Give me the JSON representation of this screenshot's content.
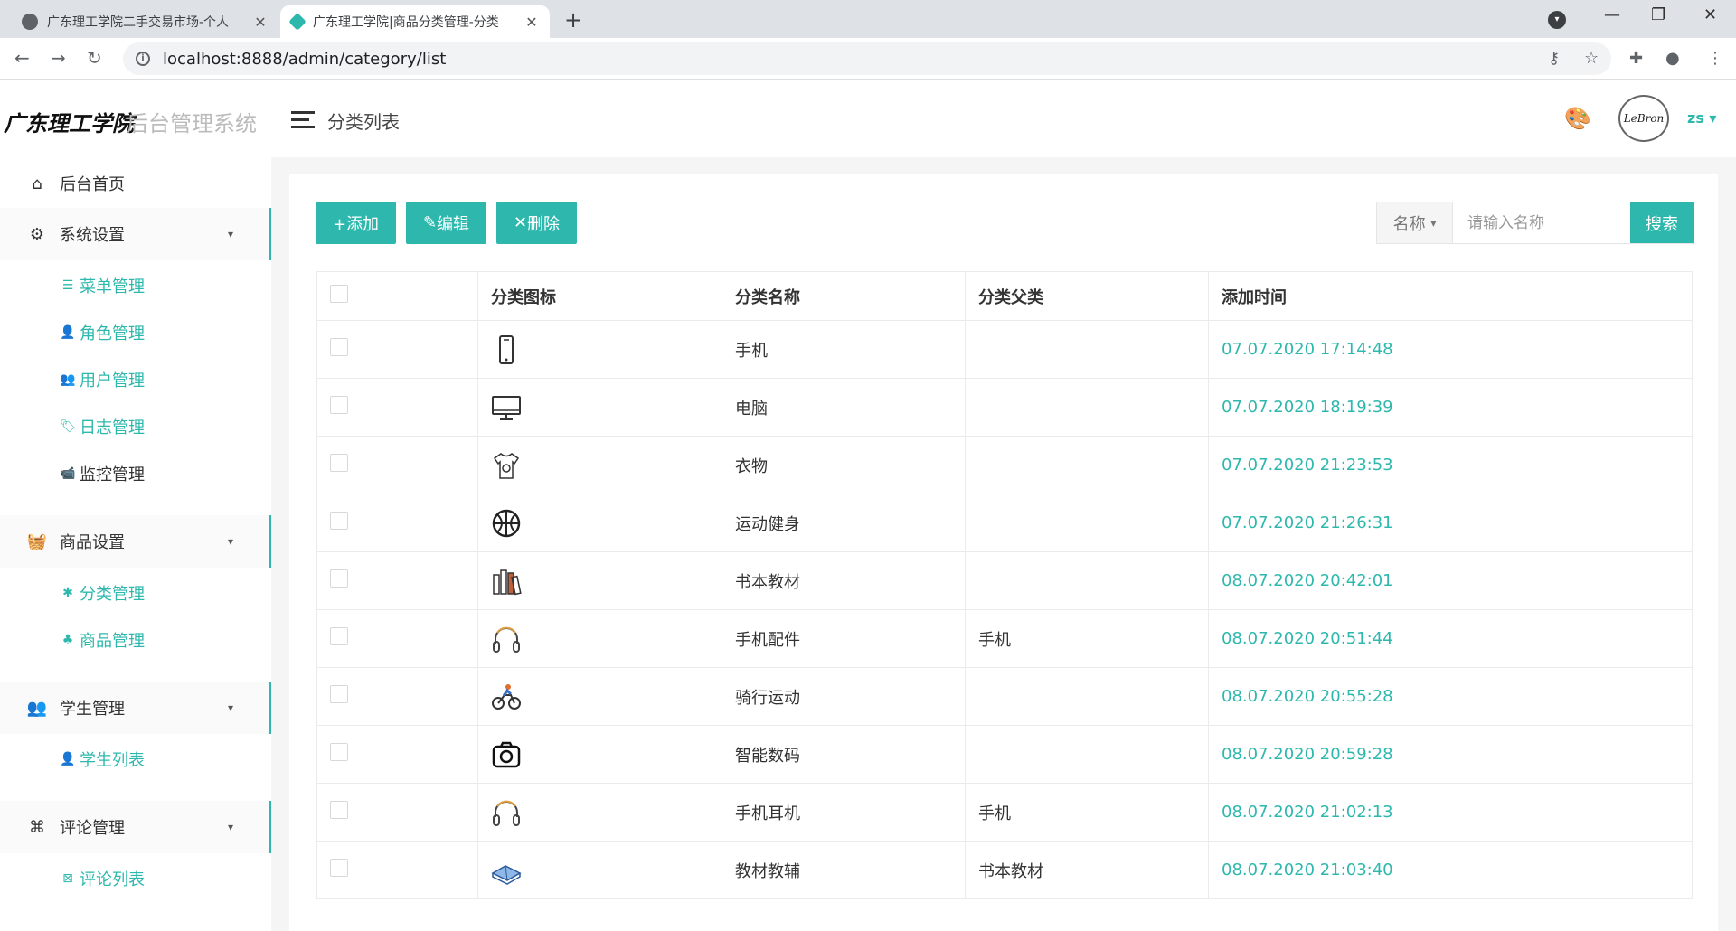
{
  "browser": {
    "tabs": [
      {
        "title": "广东理工学院二手交易市场-个人"
      },
      {
        "title": "广东理工学院|商品分类管理-分类"
      }
    ],
    "url": "localhost:8888/admin/category/list"
  },
  "header": {
    "logo": "广东理工学院",
    "logo_sub": "后台管理系统",
    "page_title": "分类列表",
    "avatar_text": "LeBron",
    "username": "zs"
  },
  "sidebar": {
    "home": "后台首页",
    "groups": [
      {
        "label": "系统设置",
        "items": [
          "菜单管理",
          "角色管理",
          "用户管理",
          "日志管理",
          "监控管理"
        ]
      },
      {
        "label": "商品设置",
        "items": [
          "分类管理",
          "商品管理"
        ]
      },
      {
        "label": "学生管理",
        "items": [
          "学生列表"
        ]
      },
      {
        "label": "评论管理",
        "items": [
          "评论列表"
        ]
      }
    ]
  },
  "toolbar": {
    "add": "+添加",
    "edit": "编辑",
    "delete": "删除",
    "search_field": "名称",
    "search_placeholder": "请输入名称",
    "search_button": "搜索"
  },
  "table": {
    "headers": [
      "分类图标",
      "分类名称",
      "分类父类",
      "添加时间"
    ],
    "rows": [
      {
        "icon": "phone-icon",
        "name": "手机",
        "parent": "",
        "time": "07.07.2020 17:14:48"
      },
      {
        "icon": "monitor-icon",
        "name": "电脑",
        "parent": "",
        "time": "07.07.2020 18:19:39"
      },
      {
        "icon": "shirt-icon",
        "name": "衣物",
        "parent": "",
        "time": "07.07.2020 21:23:53"
      },
      {
        "icon": "basketball-icon",
        "name": "运动健身",
        "parent": "",
        "time": "07.07.2020 21:26:31"
      },
      {
        "icon": "books-icon",
        "name": "书本教材",
        "parent": "",
        "time": "08.07.2020 20:42:01"
      },
      {
        "icon": "headphones-icon",
        "name": "手机配件",
        "parent": "手机",
        "time": "08.07.2020 20:51:44"
      },
      {
        "icon": "cyclist-icon",
        "name": "骑行运动",
        "parent": "",
        "time": "08.07.2020 20:55:28"
      },
      {
        "icon": "camera-icon",
        "name": "智能数码",
        "parent": "",
        "time": "08.07.2020 20:59:28"
      },
      {
        "icon": "headphones-icon",
        "name": "手机耳机",
        "parent": "手机",
        "time": "08.07.2020 21:02:13"
      },
      {
        "icon": "open-book-icon",
        "name": "教材教辅",
        "parent": "书本教材",
        "time": "08.07.2020 21:03:40"
      }
    ]
  },
  "colors": {
    "accent": "#2eb8ad"
  }
}
